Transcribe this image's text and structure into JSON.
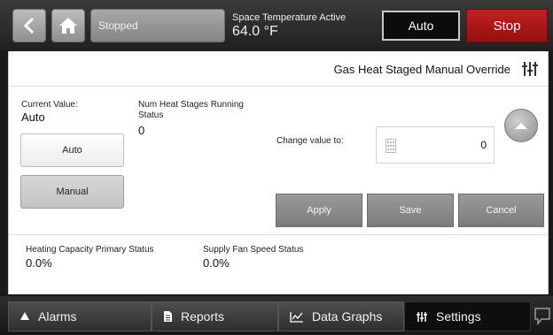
{
  "header": {
    "status": "Stopped",
    "space_temp_label": "Space Temperature Active",
    "space_temp_value": "64.0 °F",
    "auto_label": "Auto",
    "stop_label": "Stop"
  },
  "panel": {
    "title": "Gas Heat Staged Manual Override",
    "current_value_label": "Current Value:",
    "current_value": "Auto",
    "num_heat_label_line1": "Num Heat Stages Running",
    "num_heat_label_line2": "Status",
    "num_heat_value": "0",
    "mode_auto": "Auto",
    "mode_manual": "Manual",
    "change_value_label": "Change value to:",
    "change_value": "0",
    "apply": "Apply",
    "save": "Save",
    "cancel": "Cancel",
    "heating_capacity_label": "Heating Capacity Primary Status",
    "heating_capacity_value": "0.0%",
    "supply_fan_label": "Supply Fan Speed Status",
    "supply_fan_value": "0.0%"
  },
  "tabs": [
    {
      "label": "Alarms",
      "icon": "bell-icon"
    },
    {
      "label": "Reports",
      "icon": "document-icon"
    },
    {
      "label": "Data Graphs",
      "icon": "graph-icon"
    },
    {
      "label": "Settings",
      "icon": "sliders-icon",
      "active": true
    }
  ],
  "colors": {
    "stop": "#b31818",
    "active_tab": "#0e0e0e"
  }
}
